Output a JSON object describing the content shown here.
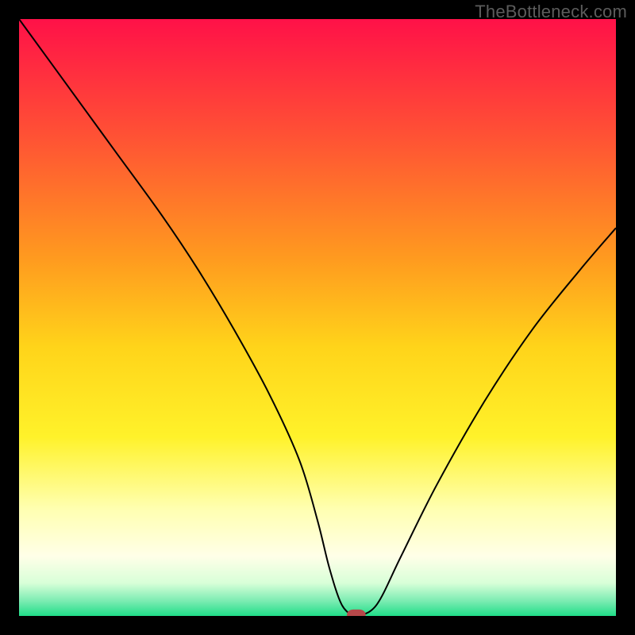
{
  "watermark": "TheBottleneck.com",
  "colors": {
    "frame": "#000000",
    "watermark": "#5c5c5c",
    "curve": "#000000",
    "marker_fill": "#b6484a",
    "marker_stroke": "#b6484a",
    "gradient_stops": [
      {
        "offset": 0,
        "color": "#ff1148"
      },
      {
        "offset": 0.2,
        "color": "#ff5334"
      },
      {
        "offset": 0.4,
        "color": "#ff9a1f"
      },
      {
        "offset": 0.55,
        "color": "#ffd41a"
      },
      {
        "offset": 0.7,
        "color": "#fff22a"
      },
      {
        "offset": 0.82,
        "color": "#ffffb0"
      },
      {
        "offset": 0.9,
        "color": "#ffffe8"
      },
      {
        "offset": 0.945,
        "color": "#d8ffd8"
      },
      {
        "offset": 0.975,
        "color": "#7becb2"
      },
      {
        "offset": 1.0,
        "color": "#20dd88"
      }
    ]
  },
  "chart_data": {
    "type": "line",
    "title": "",
    "xlabel": "",
    "ylabel": "",
    "xlim": [
      0,
      100
    ],
    "ylim": [
      0,
      100
    ],
    "grid": false,
    "legend": false,
    "series": [
      {
        "name": "bottleneck-curve",
        "x": [
          0,
          8,
          16,
          24,
          30,
          36,
          42,
          47,
          50,
          52,
          54,
          56,
          57,
          60,
          64,
          70,
          78,
          86,
          94,
          100
        ],
        "y": [
          100,
          89,
          78,
          67,
          58,
          48,
          37,
          26,
          16,
          8,
          2,
          0,
          0,
          2,
          10,
          22,
          36,
          48,
          58,
          65
        ]
      }
    ],
    "marker": {
      "x": 56.5,
      "y": 0
    },
    "notes": "V-shaped bottleneck curve on red→yellow→green vertical gradient; trough near x≈56 at y=0."
  }
}
